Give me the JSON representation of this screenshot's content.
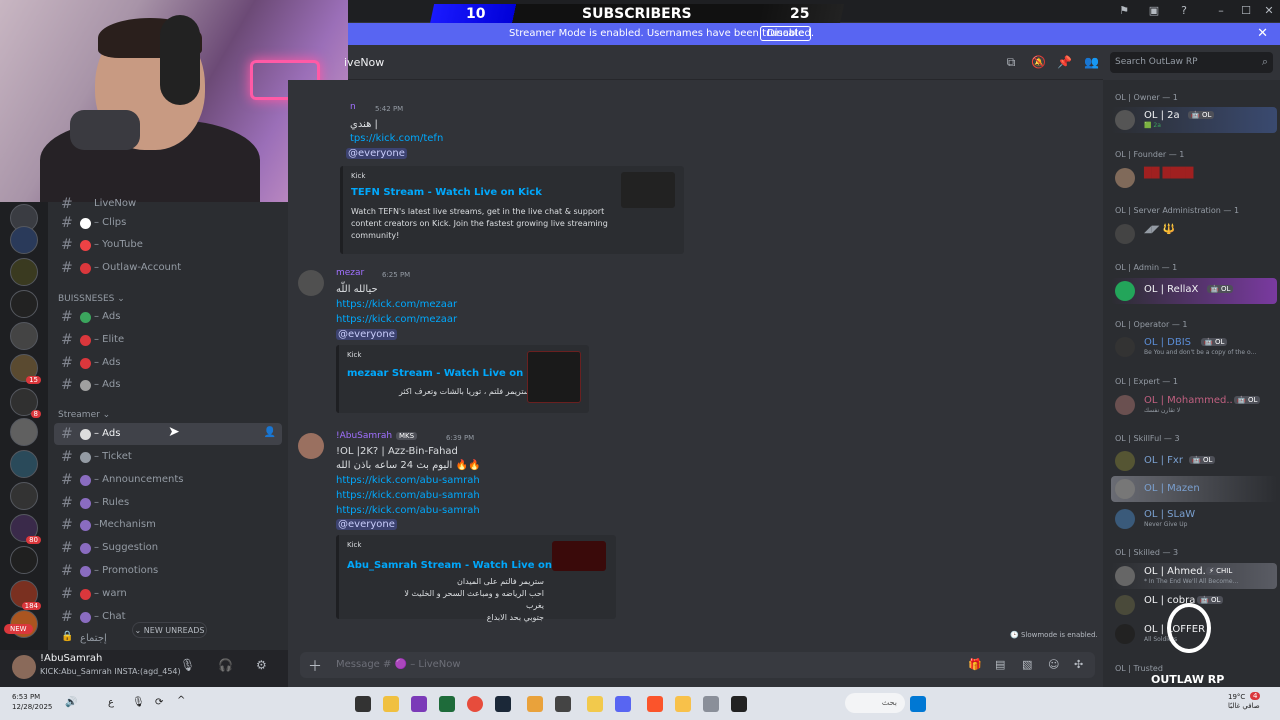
{
  "overlay": {
    "subs_left": "10",
    "subs_title": "SUBSCRIBERS",
    "subs_right": "25"
  },
  "banner": {
    "text": "Streamer Mode is enabled. Usernames have been truncated.",
    "button": "Disable",
    "close": "✕"
  },
  "header": {
    "channel": "iveNow",
    "search_placeholder": "Search OutLaw RP"
  },
  "servers": {
    "badges": [
      "15",
      "8",
      "80",
      "184"
    ],
    "new_label": "NEW"
  },
  "channels": {
    "top": [
      {
        "label": "LiveNow",
        "color": "#949ba4"
      },
      {
        "label": "– Clips",
        "color": "#ffffff"
      },
      {
        "label": "– YouTube",
        "color": "#ed4245"
      },
      {
        "label": "– Outlaw-Account",
        "color": "#da373c"
      }
    ],
    "cat_business": "BUISSNESES ⌄",
    "business": [
      {
        "label": "– Ads",
        "color": "#3ba55d"
      },
      {
        "label": "– Elite",
        "color": "#da373c"
      },
      {
        "label": "– Ads",
        "color": "#da373c"
      },
      {
        "label": "– Ads",
        "color": "#a0a0a0"
      }
    ],
    "cat_streamer": "Streamer ⌄",
    "streamer": [
      {
        "label": "– Ads",
        "color": "#dddddd",
        "selected": true
      },
      {
        "label": "– Ticket",
        "color": "#949ba4"
      },
      {
        "label": "– Announcements",
        "color": "#8a6cc0"
      },
      {
        "label": "– Rules",
        "color": "#8a6cc0"
      },
      {
        "label": "–Mechanism",
        "color": "#8a6cc0"
      },
      {
        "label": "– Suggestion",
        "color": "#8a6cc0"
      },
      {
        "label": "– Promotions",
        "color": "#8a6cc0"
      },
      {
        "label": "– warn",
        "color": "#da373c"
      },
      {
        "label": "– Chat",
        "color": "#8a6cc0"
      }
    ],
    "last_partial": "إجتماع",
    "new_unreads": "⌄ NEW UNREADS"
  },
  "user": {
    "name": "!AbuSamrah",
    "status": "KICK:Abu_Samrah INSTA:(agd_454)"
  },
  "messages": [
    {
      "author": "n",
      "time": "5:42 PM",
      "lines": [
        "هندي |",
        "tps://kick.com/tefn",
        "@everyone"
      ],
      "embed": {
        "provider": "Kick",
        "title": "TEFN Stream - Watch Live on Kick",
        "desc": [
          "Watch TEFN's latest live streams, get in the live chat & support",
          "content creators on Kick. Join the fastest growing live streaming",
          "community!"
        ]
      }
    },
    {
      "author": "mezar",
      "time": "6:25 PM",
      "lines": [
        "حيالله اللّه",
        "https://kick.com/mezaar",
        "https://kick.com/mezaar",
        "@everyone"
      ],
      "embed": {
        "provider": "Kick",
        "title": "mezaar Stream - Watch Live on Kick",
        "desc": [
          "استريمر فلتم ، توريا بالشات وتعرف اكثر"
        ]
      }
    },
    {
      "author": "!AbuSamrah",
      "tag": "MKS",
      "time": "6:39 PM",
      "lines": [
        "!OL |2K? | Azz-Bin-Fahad",
        "اليوم بث 24 ساعه باذن الله 🔥🔥",
        "https://kick.com/abu-samrah",
        "https://kick.com/abu-samrah",
        "https://kick.com/abu-samrah",
        "@everyone"
      ],
      "embed": {
        "provider": "Kick",
        "title": "Abu_Samrah Stream - Watch Live on Kick",
        "desc": [
          "ستريمر فالتم على الميدان",
          "احب الرياضه و ومباعث السحر و الخليث لا يغرب",
          "جتوبي بحد الابداع"
        ]
      }
    }
  ],
  "composer": {
    "placeholder": "Message # 🟣 – LiveNow",
    "slowmode": "🕒 Slowmode is enabled."
  },
  "members": {
    "groups": [
      {
        "title": "OL | Owner — 1",
        "members": [
          {
            "name": "OL | 2a",
            "tag": "🤖 OL",
            "sub": "🟩 2a",
            "color": "#f2f3f5"
          }
        ]
      },
      {
        "title": "OL | Founder — 1",
        "members": [
          {
            "name": "██ ████",
            "tag": "",
            "sub": "",
            "color": "#a02020"
          }
        ]
      },
      {
        "title": "OL | Server Administration — 1",
        "members": [
          {
            "name": "◢◤ 🔱",
            "tag": "",
            "sub": "",
            "color": "#949ba4"
          }
        ]
      },
      {
        "title": "OL | Admin — 1",
        "members": [
          {
            "name": "OL | RellaX",
            "tag": "🤖 OL",
            "sub": "",
            "color": "#f2f3f5"
          }
        ]
      },
      {
        "title": "OL | Operator — 1",
        "members": [
          {
            "name": "OL | DBIS",
            "tag": "🤖 OL",
            "sub": "Be You and don't be a copy of the o...",
            "color": "#5b8dd6"
          }
        ]
      },
      {
        "title": "OL | Expert — 1",
        "members": [
          {
            "name": "OL | Mohammed..",
            "tag": "🤖 OL",
            "sub": "لا تقارن نفسك",
            "color": "#c06080"
          }
        ]
      },
      {
        "title": "OL | SkillFul — 3",
        "members": [
          {
            "name": "OL | Fxr",
            "tag": "🤖 OL",
            "sub": "",
            "color": "#7aa0d0"
          },
          {
            "name": "OL | Mazen",
            "tag": "",
            "sub": "",
            "color": "#7aa0d0"
          },
          {
            "name": "OL | SLaW",
            "tag": "",
            "sub": "Never Give Up",
            "color": "#7aa0d0"
          }
        ]
      },
      {
        "title": "OL | Skilled — 3",
        "members": [
          {
            "name": "OL | Ahmed.",
            "tag": "⚡ CHIL",
            "sub": "* In The End We'll All Become...",
            "color": "#f2f3f5"
          },
          {
            "name": "OL | cobra",
            "tag": "🤖 OL",
            "sub": "",
            "color": "#f2f3f5"
          },
          {
            "name": "OL | LOFFER",
            "tag": "",
            "sub": "All Soldiers",
            "color": "#f2f3f5"
          }
        ]
      },
      {
        "title": "OL | Trusted",
        "members": []
      }
    ]
  },
  "logo": {
    "text": "OUTLAW RP"
  },
  "taskbar": {
    "time": "6:53 PM",
    "date": "12/28/2025",
    "search": "بحث",
    "lang": "ع",
    "temp": "19°C",
    "weather": "صافي غالبًا",
    "notif": "4"
  },
  "colors": {
    "accent": "#5865f2",
    "bg": "#313338",
    "sidebar": "#2b2d31",
    "servers": "#1e1f22"
  }
}
